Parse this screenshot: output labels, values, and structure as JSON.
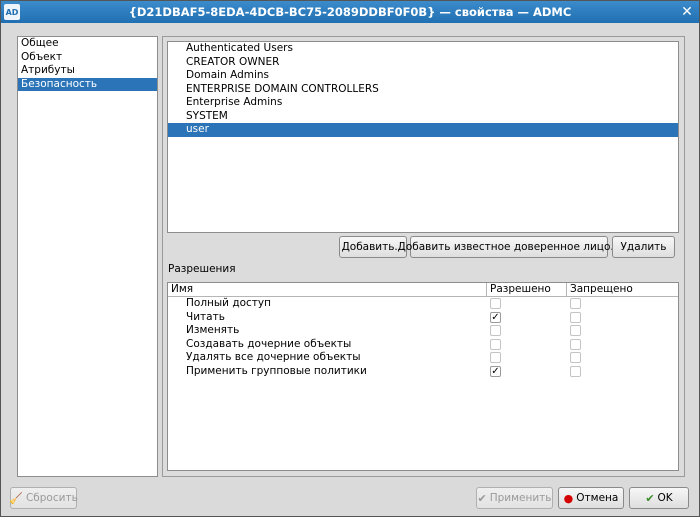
{
  "window": {
    "app_badge": "AD",
    "title": "{D21DBAF5-8EDA-4DCB-BC75-2089DDBF0F0B} — свойства — ADMC",
    "close_glyph": "✕"
  },
  "nav": {
    "items": [
      {
        "label": "Общее",
        "selected": false
      },
      {
        "label": "Объект",
        "selected": false
      },
      {
        "label": "Атрибуты",
        "selected": false
      },
      {
        "label": "Безопасность",
        "selected": true
      }
    ]
  },
  "principals": {
    "items": [
      {
        "label": "Authenticated Users",
        "selected": false
      },
      {
        "label": "CREATOR OWNER",
        "selected": false
      },
      {
        "label": "Domain Admins",
        "selected": false
      },
      {
        "label": "ENTERPRISE DOMAIN CONTROLLERS",
        "selected": false
      },
      {
        "label": "Enterprise Admins",
        "selected": false
      },
      {
        "label": "SYSTEM",
        "selected": false
      },
      {
        "label": "user",
        "selected": true
      }
    ]
  },
  "actions": {
    "add": "Добавить...",
    "add_trusted": "Добавить известное доверенное лицо...",
    "remove": "Удалить"
  },
  "permissions": {
    "label": "Разрешения",
    "columns": {
      "name": "Имя",
      "allowed": "Разрешено",
      "denied": "Запрещено"
    },
    "rows": [
      {
        "name": "Полный доступ",
        "allowed": false,
        "denied": false
      },
      {
        "name": "Читать",
        "allowed": true,
        "denied": false
      },
      {
        "name": "Изменять",
        "allowed": false,
        "denied": false
      },
      {
        "name": "Создавать дочерние объекты",
        "allowed": false,
        "denied": false
      },
      {
        "name": "Удалять все дочерние объекты",
        "allowed": false,
        "denied": false
      },
      {
        "name": "Применить групповые политики",
        "allowed": true,
        "denied": false
      }
    ]
  },
  "footer": {
    "reset": "Сбросить",
    "apply": "Применить",
    "cancel": "Отмена",
    "ok": "OK"
  },
  "colors": {
    "selection": "#2b74b8",
    "titlebar": "#1f6fb2",
    "cancel_icon": "#d40000",
    "ok_icon": "#3a8a2a"
  }
}
